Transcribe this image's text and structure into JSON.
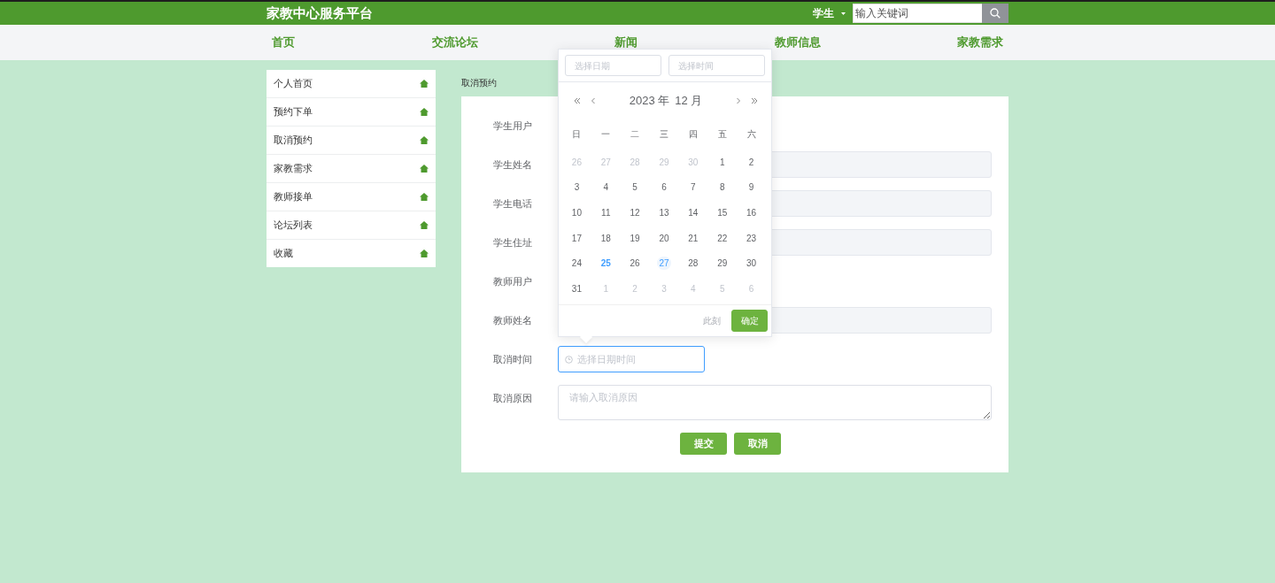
{
  "header": {
    "brand": "家教中心服务平台",
    "user_menu": "学生",
    "search": {
      "placeholder": "输入关键词"
    }
  },
  "nav": [
    {
      "label": "首页"
    },
    {
      "label": "交流论坛"
    },
    {
      "label": "新闻"
    },
    {
      "label": "教师信息"
    },
    {
      "label": "家教需求"
    }
  ],
  "sidebar": [
    {
      "label": "个人首页"
    },
    {
      "label": "预约下单"
    },
    {
      "label": "取消预约"
    },
    {
      "label": "家教需求"
    },
    {
      "label": "教师接单"
    },
    {
      "label": "论坛列表"
    },
    {
      "label": "收藏"
    }
  ],
  "breadcrumb": "取消预约",
  "form": {
    "fields": [
      {
        "label": "学生用户",
        "kind": "text"
      },
      {
        "label": "学生姓名",
        "kind": "input",
        "disabled": true
      },
      {
        "label": "学生电话",
        "kind": "input",
        "disabled": true
      },
      {
        "label": "学生住址",
        "kind": "input",
        "disabled": true
      },
      {
        "label": "教师用户",
        "kind": "text"
      },
      {
        "label": "教师姓名",
        "kind": "input",
        "disabled": true
      },
      {
        "label": "取消时间",
        "kind": "datetime",
        "placeholder": "选择日期时间",
        "focused": true
      },
      {
        "label": "取消原因",
        "kind": "textarea",
        "placeholder": "请输入取消原因"
      }
    ],
    "buttons": [
      {
        "label": "提交"
      },
      {
        "label": "取消"
      }
    ]
  },
  "date_picker": {
    "date_placeholder": "选择日期",
    "time_placeholder": "选择时间",
    "year": "2023 年",
    "month": "12 月",
    "weekdays": [
      "日",
      "一",
      "二",
      "三",
      "四",
      "五",
      "六"
    ],
    "days": [
      {
        "day": "26",
        "kind": "prev",
        "today": false,
        "selected": false
      },
      {
        "day": "27",
        "kind": "prev",
        "today": false,
        "selected": false
      },
      {
        "day": "28",
        "kind": "prev",
        "today": false,
        "selected": false
      },
      {
        "day": "29",
        "kind": "prev",
        "today": false,
        "selected": false
      },
      {
        "day": "30",
        "kind": "prev",
        "today": false,
        "selected": false
      },
      {
        "day": "1",
        "kind": "cur",
        "today": false,
        "selected": false
      },
      {
        "day": "2",
        "kind": "cur",
        "today": false,
        "selected": false
      },
      {
        "day": "3",
        "kind": "cur",
        "today": false,
        "selected": false
      },
      {
        "day": "4",
        "kind": "cur",
        "today": false,
        "selected": false
      },
      {
        "day": "5",
        "kind": "cur",
        "today": false,
        "selected": false
      },
      {
        "day": "6",
        "kind": "cur",
        "today": false,
        "selected": false
      },
      {
        "day": "7",
        "kind": "cur",
        "today": false,
        "selected": false
      },
      {
        "day": "8",
        "kind": "cur",
        "today": false,
        "selected": false
      },
      {
        "day": "9",
        "kind": "cur",
        "today": false,
        "selected": false
      },
      {
        "day": "10",
        "kind": "cur",
        "today": false,
        "selected": false
      },
      {
        "day": "11",
        "kind": "cur",
        "today": false,
        "selected": false
      },
      {
        "day": "12",
        "kind": "cur",
        "today": false,
        "selected": false
      },
      {
        "day": "13",
        "kind": "cur",
        "today": false,
        "selected": false
      },
      {
        "day": "14",
        "kind": "cur",
        "today": false,
        "selected": false
      },
      {
        "day": "15",
        "kind": "cur",
        "today": false,
        "selected": false
      },
      {
        "day": "16",
        "kind": "cur",
        "today": false,
        "selected": false
      },
      {
        "day": "17",
        "kind": "cur",
        "today": false,
        "selected": false
      },
      {
        "day": "18",
        "kind": "cur",
        "today": false,
        "selected": false
      },
      {
        "day": "19",
        "kind": "cur",
        "today": false,
        "selected": false
      },
      {
        "day": "20",
        "kind": "cur",
        "today": false,
        "selected": false
      },
      {
        "day": "21",
        "kind": "cur",
        "today": false,
        "selected": false
      },
      {
        "day": "22",
        "kind": "cur",
        "today": false,
        "selected": false
      },
      {
        "day": "23",
        "kind": "cur",
        "today": false,
        "selected": false
      },
      {
        "day": "24",
        "kind": "cur",
        "today": false,
        "selected": false
      },
      {
        "day": "25",
        "kind": "cur",
        "today": true,
        "selected": false
      },
      {
        "day": "26",
        "kind": "cur",
        "today": false,
        "selected": false
      },
      {
        "day": "27",
        "kind": "cur",
        "today": false,
        "selected": true
      },
      {
        "day": "28",
        "kind": "cur",
        "today": false,
        "selected": false
      },
      {
        "day": "29",
        "kind": "cur",
        "today": false,
        "selected": false
      },
      {
        "day": "30",
        "kind": "cur",
        "today": false,
        "selected": false
      },
      {
        "day": "31",
        "kind": "cur",
        "today": false,
        "selected": false
      },
      {
        "day": "1",
        "kind": "next",
        "today": false,
        "selected": false
      },
      {
        "day": "2",
        "kind": "next",
        "today": false,
        "selected": false
      },
      {
        "day": "3",
        "kind": "next",
        "today": false,
        "selected": false
      },
      {
        "day": "4",
        "kind": "next",
        "today": false,
        "selected": false
      },
      {
        "day": "5",
        "kind": "next",
        "today": false,
        "selected": false
      },
      {
        "day": "6",
        "kind": "next",
        "today": false,
        "selected": false
      }
    ],
    "now_label": "此刻",
    "confirm": "确定"
  }
}
